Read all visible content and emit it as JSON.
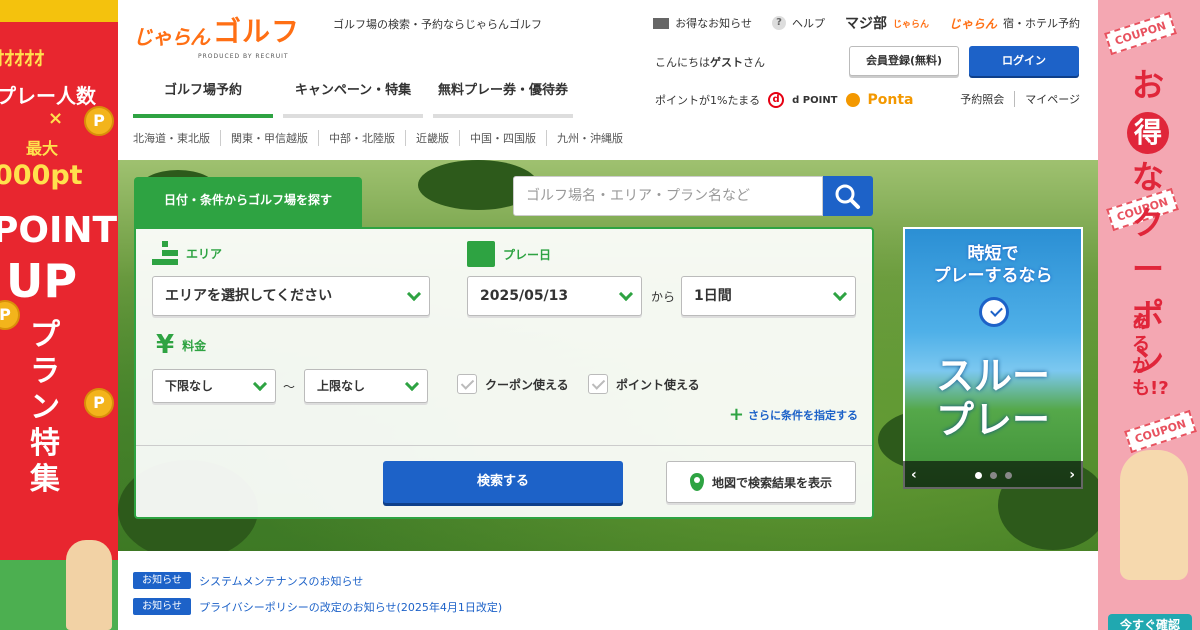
{
  "left_banner": {
    "line1": "ｵｵｵｵｵ",
    "line2": "プレー人数",
    "times": "×",
    "line3": "最大",
    "line4": "000pt",
    "point": "POINT",
    "up": "UP",
    "plan": "プラン特集",
    "coin": "P"
  },
  "right_banner": {
    "coupon_tag": "COUPON",
    "o": "お",
    "toku": "得",
    "text": "なクーポン",
    "maybe": "あるかも!?",
    "cta": "今すぐ確認"
  },
  "header": {
    "logo_jaran": "じゃらん",
    "logo_golf": "ゴルフ",
    "logo_sub": "PRODUCED BY RECRUIT",
    "tagline": "ゴルフ場の検索・予約ならじゃらんゴルフ",
    "top_links": {
      "news": "お得なお知らせ",
      "help": "ヘルプ",
      "maji": "マジ部",
      "maji_sub": "じゃらん",
      "yado_logo": "じゃらん",
      "yado": "宿・ホテル予約"
    },
    "greeting_prefix": "こんにちは",
    "greeting_name": "ゲスト",
    "greeting_suffix": "さん",
    "register_button": "会員登録(無料)",
    "login_button": "ログイン",
    "points_text": "ポイントが1%たまる",
    "d_icon": "d",
    "dpoint": "POINT",
    "ponta": "Ponta",
    "account_links": [
      "予約照会",
      "マイページ"
    ]
  },
  "tabs": [
    {
      "label": "ゴルフ場予約",
      "active": true
    },
    {
      "label": "キャンペーン・特集",
      "active": false
    },
    {
      "label": "無料プレー券・優待券",
      "active": false
    }
  ],
  "regions": [
    "北海道・東北版",
    "関東・甲信越版",
    "中部・北陸版",
    "近畿版",
    "中国・四国版",
    "九州・沖縄版"
  ],
  "search": {
    "tab_label": "日付・条件からゴルフ場を探す",
    "keyword_placeholder": "ゴルフ場名・エリア・プラン名など",
    "area_label": "エリア",
    "area_value": "エリアを選択してください",
    "date_label": "プレー日",
    "date_value": "2025/05/13",
    "from": "から",
    "days_value": "1日間",
    "price_label": "料金",
    "price_min": "下限なし",
    "tilde": "〜",
    "price_max": "上限なし",
    "coupon_check": "クーポン使える",
    "point_check": "ポイント使える",
    "more_conditions": "さらに条件を指定する",
    "plus": "+",
    "search_button": "検索する",
    "map_button": "地図で検索結果を表示"
  },
  "promo": {
    "line1": "時短で",
    "line2": "プレーするなら",
    "title1": "スルー",
    "title2": "プレー",
    "prev": "‹",
    "next": "›"
  },
  "notices": [
    {
      "tag": "お知らせ",
      "title": "システムメンテナンスのお知らせ"
    },
    {
      "tag": "お知らせ",
      "title": "プライバシーポリシーの改定のお知らせ(2025年4月1日改定)"
    }
  ],
  "colors": {
    "brand_orange": "#ff6f14",
    "green": "#2ea342",
    "blue": "#1d62c8"
  }
}
